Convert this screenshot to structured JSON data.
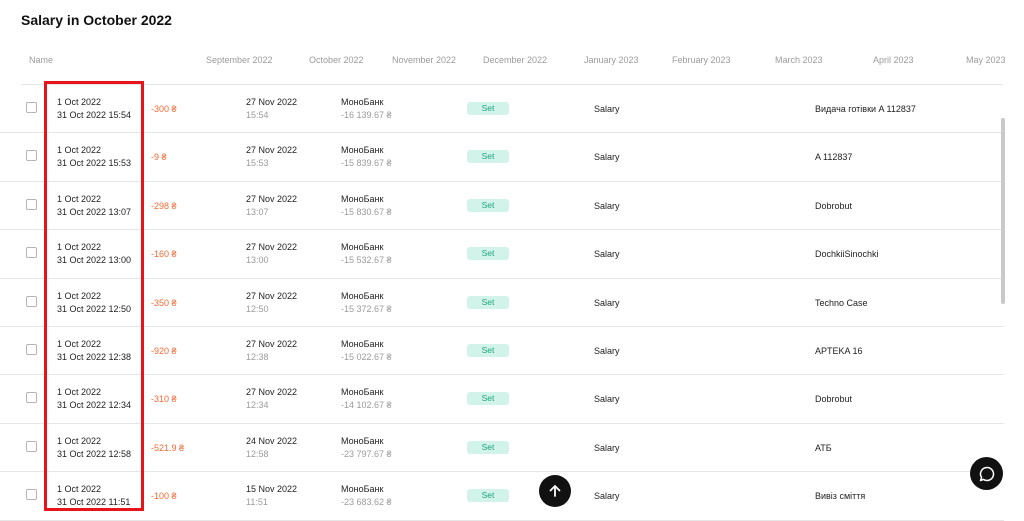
{
  "page": {
    "title": "Salary in October 2022"
  },
  "columns": [
    "Name",
    "September 2022",
    "October 2022",
    "November 2022",
    "December 2022",
    "January 2023",
    "February 2023",
    "March 2023",
    "April 2023",
    "May 2023"
  ],
  "rows": [
    {
      "date_from": "1 Oct 2022",
      "date_to": "31 Oct 2022 15:54",
      "amount": "-300 ₴",
      "tx_date": "27 Nov 2022",
      "tx_time": "15:54",
      "bank": "МоноБанк",
      "balance": "-16 139.67 ₴",
      "status": "Set",
      "category": "Salary",
      "description": "Видача готівки A 112837"
    },
    {
      "date_from": "1 Oct 2022",
      "date_to": "31 Oct 2022 15:53",
      "amount": "-9 ₴",
      "tx_date": "27 Nov 2022",
      "tx_time": "15:53",
      "bank": "МоноБанк",
      "balance": "-15 839.67 ₴",
      "status": "Set",
      "category": "Salary",
      "description": "A 112837"
    },
    {
      "date_from": "1 Oct 2022",
      "date_to": "31 Oct 2022 13:07",
      "amount": "-298 ₴",
      "tx_date": "27 Nov 2022",
      "tx_time": "13:07",
      "bank": "МоноБанк",
      "balance": "-15 830.67 ₴",
      "status": "Set",
      "category": "Salary",
      "description": "Dobrobut"
    },
    {
      "date_from": "1 Oct 2022",
      "date_to": "31 Oct 2022 13:00",
      "amount": "-160 ₴",
      "tx_date": "27 Nov 2022",
      "tx_time": "13:00",
      "bank": "МоноБанк",
      "balance": "-15 532.67 ₴",
      "status": "Set",
      "category": "Salary",
      "description": "DochkiiSinochki"
    },
    {
      "date_from": "1 Oct 2022",
      "date_to": "31 Oct 2022 12:50",
      "amount": "-350 ₴",
      "tx_date": "27 Nov 2022",
      "tx_time": "12:50",
      "bank": "МоноБанк",
      "balance": "-15 372.67 ₴",
      "status": "Set",
      "category": "Salary",
      "description": "Techno Case"
    },
    {
      "date_from": "1 Oct 2022",
      "date_to": "31 Oct 2022 12:38",
      "amount": "-920 ₴",
      "tx_date": "27 Nov 2022",
      "tx_time": "12:38",
      "bank": "МоноБанк",
      "balance": "-15 022.67 ₴",
      "status": "Set",
      "category": "Salary",
      "description": "APTEKA 16"
    },
    {
      "date_from": "1 Oct 2022",
      "date_to": "31 Oct 2022 12:34",
      "amount": "-310 ₴",
      "tx_date": "27 Nov 2022",
      "tx_time": "12:34",
      "bank": "МоноБанк",
      "balance": "-14 102.67 ₴",
      "status": "Set",
      "category": "Salary",
      "description": "Dobrobut"
    },
    {
      "date_from": "1 Oct 2022",
      "date_to": "31 Oct 2022 12:58",
      "amount": "-521.9 ₴",
      "tx_date": "24 Nov 2022",
      "tx_time": "12:58",
      "bank": "МоноБанк",
      "balance": "-23 797.67 ₴",
      "status": "Set",
      "category": "Salary",
      "description": "АТБ"
    },
    {
      "date_from": "1 Oct 2022",
      "date_to": "31 Oct 2022 11:51",
      "amount": "-100 ₴",
      "tx_date": "15 Nov 2022",
      "tx_time": "11:51",
      "bank": "МоноБанк",
      "balance": "-23 683.62 ₴",
      "status": "Set",
      "category": "Salary",
      "description": "Вивіз сміття"
    }
  ],
  "colors": {
    "accent_red": "#e8141b",
    "amount_negative": "#f06a35",
    "badge_bg": "#d2f3ea",
    "badge_text": "#1fa37c"
  },
  "icons": {
    "scroll_top": "arrow-up-icon",
    "chat": "chat-bubble-icon"
  }
}
